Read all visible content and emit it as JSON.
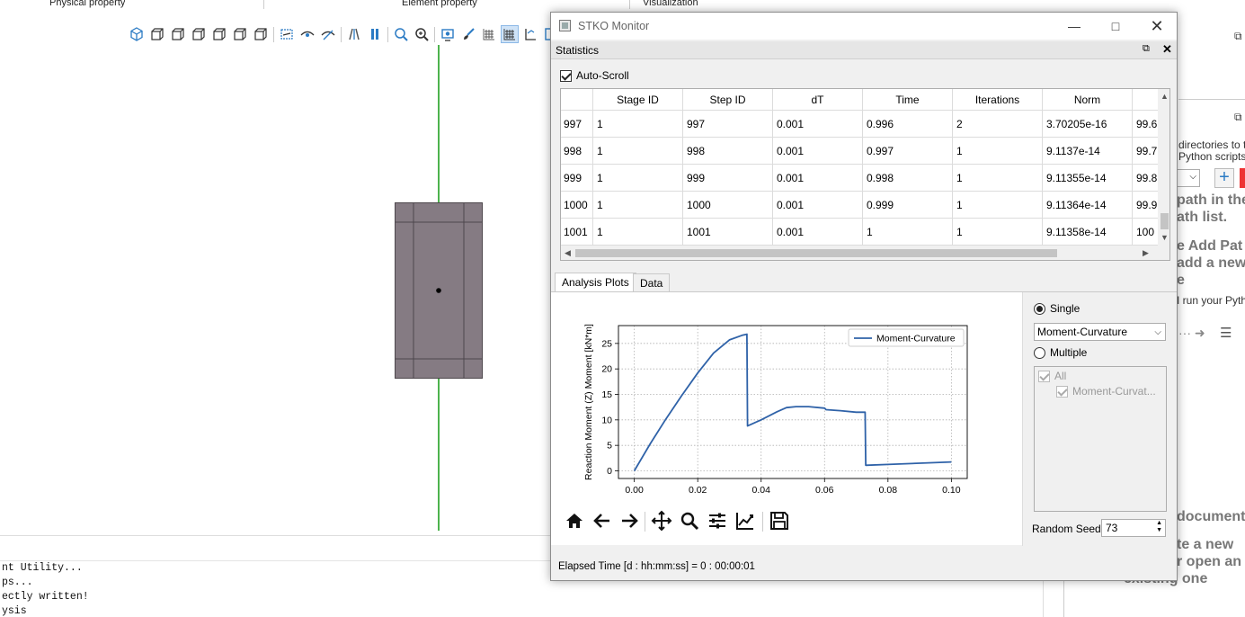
{
  "background": {
    "tabs": [
      "Physical property",
      "Element property",
      "Visualization"
    ],
    "console_lines": [
      "nt Utility...",
      "ps...",
      "ectly written!",
      "ysis"
    ],
    "right_panel": {
      "help_line1": "directories to th",
      "help_line2": "Python scripts",
      "big1": "path in the",
      "big2": "ath list.",
      "big3": "e Add Pat",
      "big4": "add a new",
      "big5": "e",
      "small1": "I run your Pytho",
      "big6": "document",
      "big7": "te a new",
      "big8": "r open an",
      "big9": "existing one"
    }
  },
  "window": {
    "title": "STKO Monitor",
    "statistics": {
      "title": "Statistics",
      "auto_scroll_label": "Auto-Scroll",
      "columns": [
        "Stage ID",
        "Step ID",
        "dT",
        "Time",
        "Iterations",
        "Norm",
        ""
      ],
      "rows": [
        {
          "num": "997",
          "cells": [
            "1",
            "997",
            "0.001",
            "0.996",
            "2",
            "3.70205e-16",
            "99.6"
          ]
        },
        {
          "num": "998",
          "cells": [
            "1",
            "998",
            "0.001",
            "0.997",
            "1",
            "9.1137e-14",
            "99.7"
          ]
        },
        {
          "num": "999",
          "cells": [
            "1",
            "999",
            "0.001",
            "0.998",
            "1",
            "9.11355e-14",
            "99.8"
          ]
        },
        {
          "num": "1000",
          "cells": [
            "1",
            "1000",
            "0.001",
            "0.999",
            "1",
            "9.11364e-14",
            "99.9"
          ]
        },
        {
          "num": "1001",
          "cells": [
            "1",
            "1001",
            "0.001",
            "1",
            "1",
            "9.11358e-14",
            "100"
          ]
        }
      ]
    },
    "tabs": [
      "Analysis Plots",
      "Data"
    ],
    "side": {
      "single_label": "Single",
      "single_selected": "Moment-Curvature",
      "multiple_label": "Multiple",
      "tree_all": "All",
      "tree_child": "Moment-Curvat...",
      "random_seed_label": "Random Seed:",
      "random_seed_value": "73"
    },
    "status": "Elapsed Time [d : hh:mm:ss] = 0 : 00:00:01"
  },
  "chart_data": {
    "type": "line",
    "title": "",
    "xlabel": "",
    "ylabel": "Reaction Moment (Z) Moment [kN*m]",
    "xlim": [
      -0.005,
      0.105
    ],
    "ylim": [
      -1.5,
      28.5
    ],
    "xticks": [
      "0.00",
      "0.02",
      "0.04",
      "0.06",
      "0.08",
      "0.10"
    ],
    "yticks": [
      "0",
      "5",
      "10",
      "15",
      "20",
      "25"
    ],
    "grid": true,
    "legend_position": "top-right",
    "series": [
      {
        "name": "Moment-Curvature",
        "color": "#2f62a8",
        "x": [
          0,
          0.005,
          0.01,
          0.015,
          0.02,
          0.025,
          0.03,
          0.034,
          0.0355,
          0.0357,
          0.04,
          0.045,
          0.048,
          0.051,
          0.055,
          0.06,
          0.0605,
          0.065,
          0.07,
          0.0728,
          0.073,
          0.08,
          0.09,
          0.1
        ],
        "y": [
          0,
          5.3,
          10.2,
          14.8,
          19.2,
          23.1,
          25.7,
          26.6,
          26.8,
          8.8,
          10.0,
          11.6,
          12.4,
          12.6,
          12.6,
          12.3,
          12.0,
          11.8,
          11.5,
          11.5,
          1.1,
          1.25,
          1.5,
          1.75
        ]
      }
    ]
  }
}
